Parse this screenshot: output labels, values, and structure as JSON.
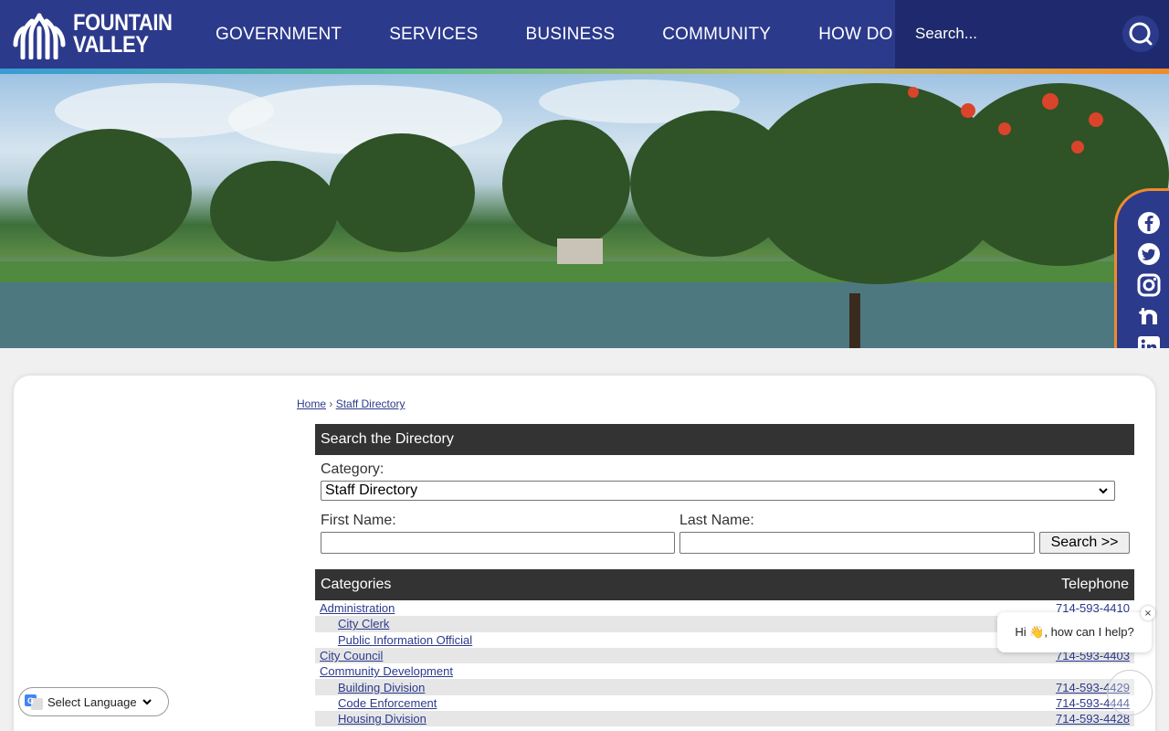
{
  "logo": {
    "line1": "FOUNTAIN",
    "line2": "VALLEY"
  },
  "nav": [
    "GOVERNMENT",
    "SERVICES",
    "BUSINESS",
    "COMMUNITY",
    "HOW DO I..."
  ],
  "search": {
    "placeholder": "Search..."
  },
  "social": [
    "facebook-icon",
    "twitter-icon",
    "instagram-icon",
    "nextdoor-icon",
    "linkedin-icon"
  ],
  "breadcrumb": {
    "home": "Home",
    "sep": "›",
    "current": "Staff Directory"
  },
  "directory": {
    "heading": "Search the Directory",
    "category_label": "Category:",
    "category_value": "Staff Directory",
    "first_name_label": "First Name:",
    "last_name_label": "Last Name:",
    "search_button": "Search >>"
  },
  "table": {
    "col_categories": "Categories",
    "col_telephone": "Telephone",
    "rows": [
      {
        "name": "Administration",
        "phone": "714-593-4410",
        "sub": false
      },
      {
        "name": "City Clerk",
        "phone": "",
        "sub": true
      },
      {
        "name": "Public Information Official",
        "phone": "",
        "sub": true
      },
      {
        "name": "City Council",
        "phone": "714-593-4403",
        "sub": false
      },
      {
        "name": "Community Development",
        "phone": "",
        "sub": false
      },
      {
        "name": "Building Division",
        "phone": "714-593-4429",
        "sub": true
      },
      {
        "name": "Code Enforcement",
        "phone": "714-593-4444",
        "sub": true
      },
      {
        "name": "Housing Division",
        "phone": "714-593-4428",
        "sub": true
      }
    ]
  },
  "language": {
    "label": "Select Language"
  },
  "chat": {
    "message": "Hi 👋, how can I help?",
    "close": "×"
  },
  "colors": {
    "header": "#2c3a8c",
    "accent": "#f08a2a",
    "panel": "#333333"
  }
}
